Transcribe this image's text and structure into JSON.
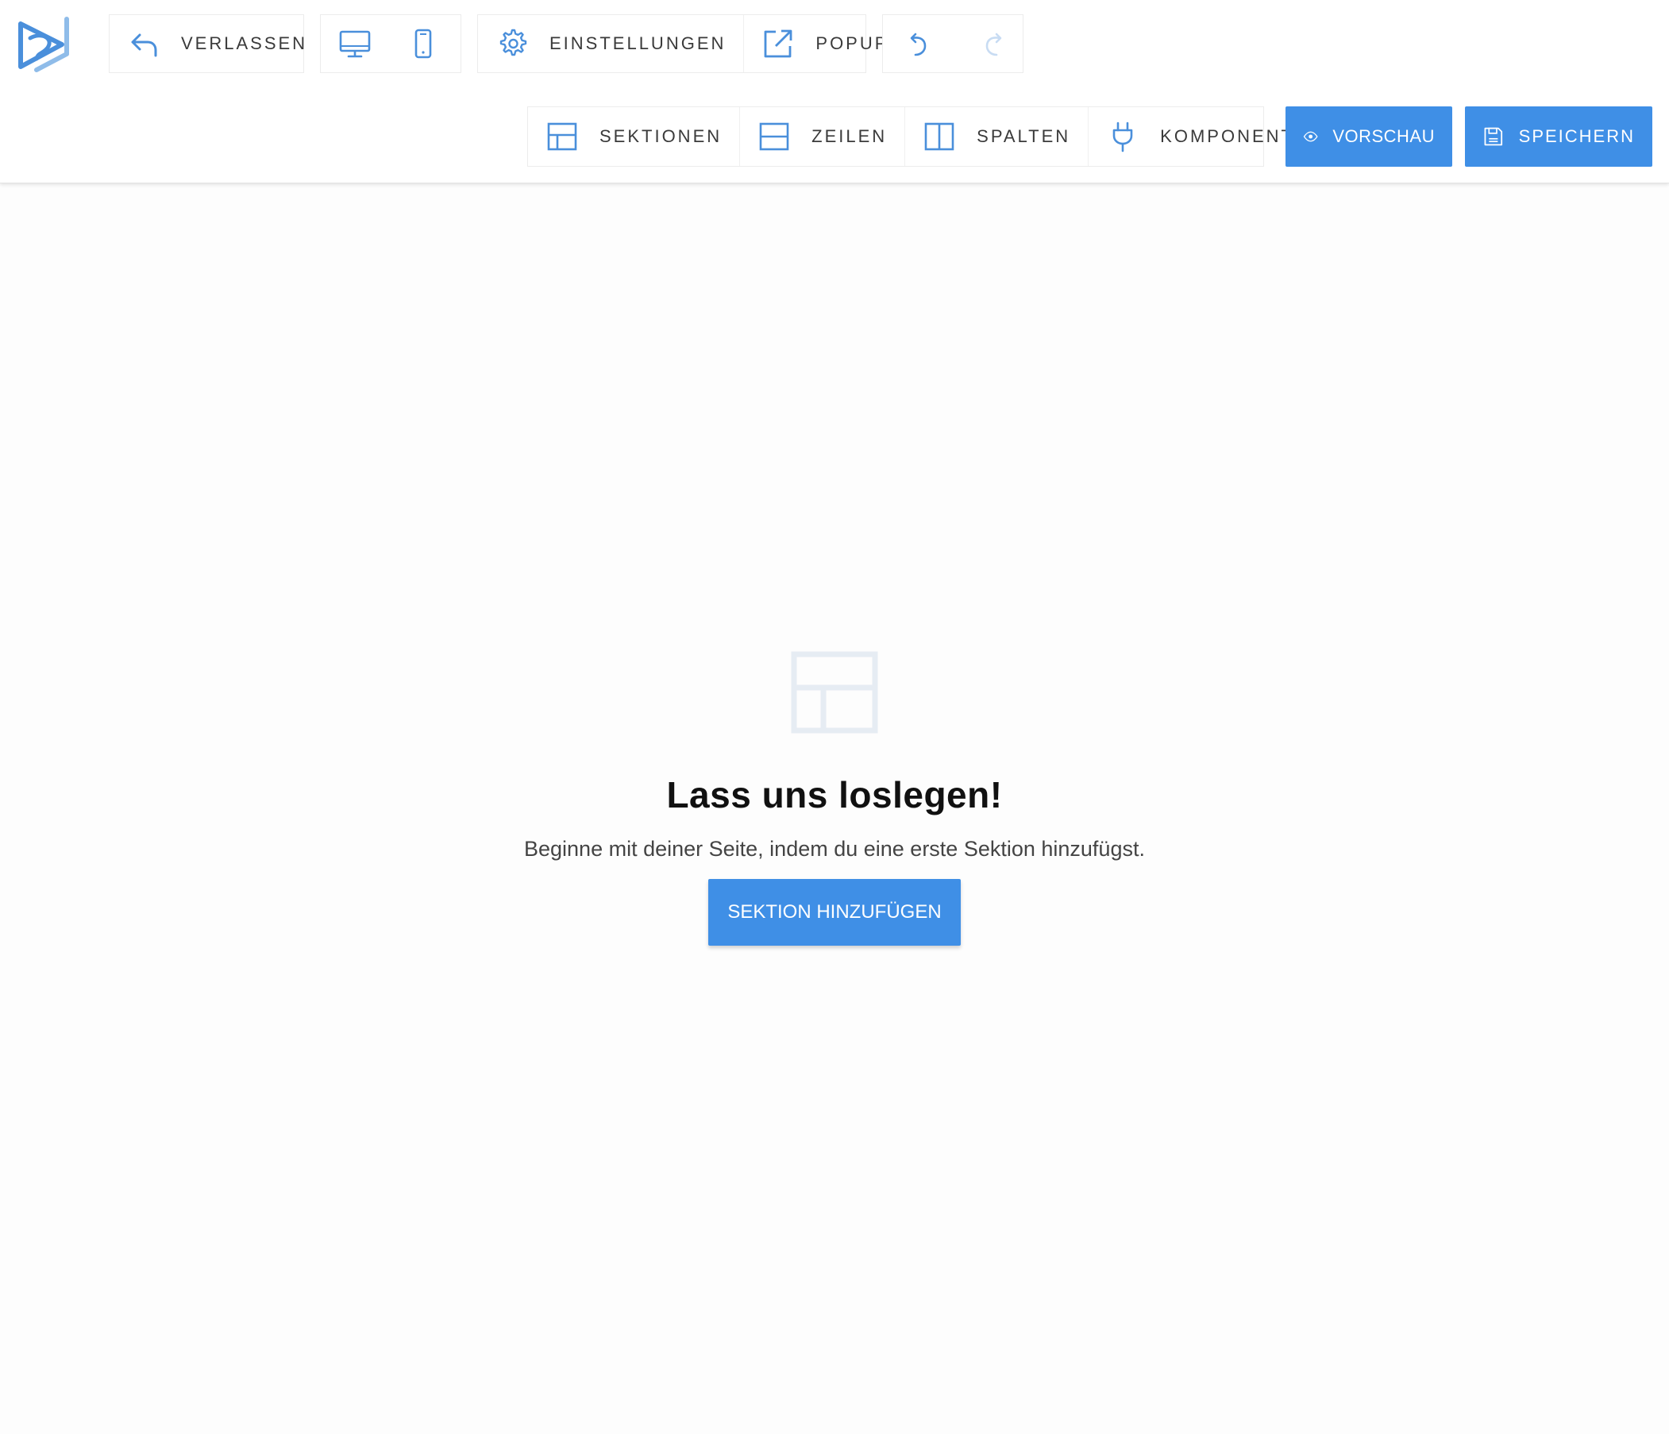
{
  "colors": {
    "accent": "#3f8fe6",
    "icon": "#4a8fdb",
    "disabled_icon": "#c8dcf3"
  },
  "logo": {
    "icon": "s-play-logo"
  },
  "toolbar_top": {
    "exit": {
      "label": "VERLASSEN",
      "icon": "undo-arrow-icon"
    },
    "devices": [
      {
        "icon": "desktop-icon"
      },
      {
        "icon": "mobile-icon"
      }
    ],
    "settings": {
      "label": "EINSTELLUNGEN",
      "icon": "gear-icon"
    },
    "popup": {
      "label": "POPUP",
      "icon": "external-link-icon"
    },
    "history": [
      {
        "icon": "undo-icon",
        "enabled": true
      },
      {
        "icon": "redo-icon",
        "enabled": false
      }
    ]
  },
  "toolbar_bottom": {
    "items": [
      {
        "label": "SEKTIONEN",
        "icon": "sections-layout-icon"
      },
      {
        "label": "ZEILEN",
        "icon": "rows-layout-icon"
      },
      {
        "label": "SPALTEN",
        "icon": "columns-layout-icon"
      },
      {
        "label": "KOMPONENTEN",
        "icon": "plug-icon"
      }
    ],
    "preview": {
      "label": "VORSCHAU",
      "icon": "eye-icon"
    },
    "save": {
      "label": "SPEICHERN",
      "icon": "floppy-disk-icon"
    }
  },
  "empty_state": {
    "icon": "sections-layout-icon",
    "title": "Lass uns loslegen!",
    "description": "Beginne mit deiner Seite, indem du eine erste Sektion hinzufügst.",
    "button_label": "SEKTION HINZUFÜGEN"
  }
}
